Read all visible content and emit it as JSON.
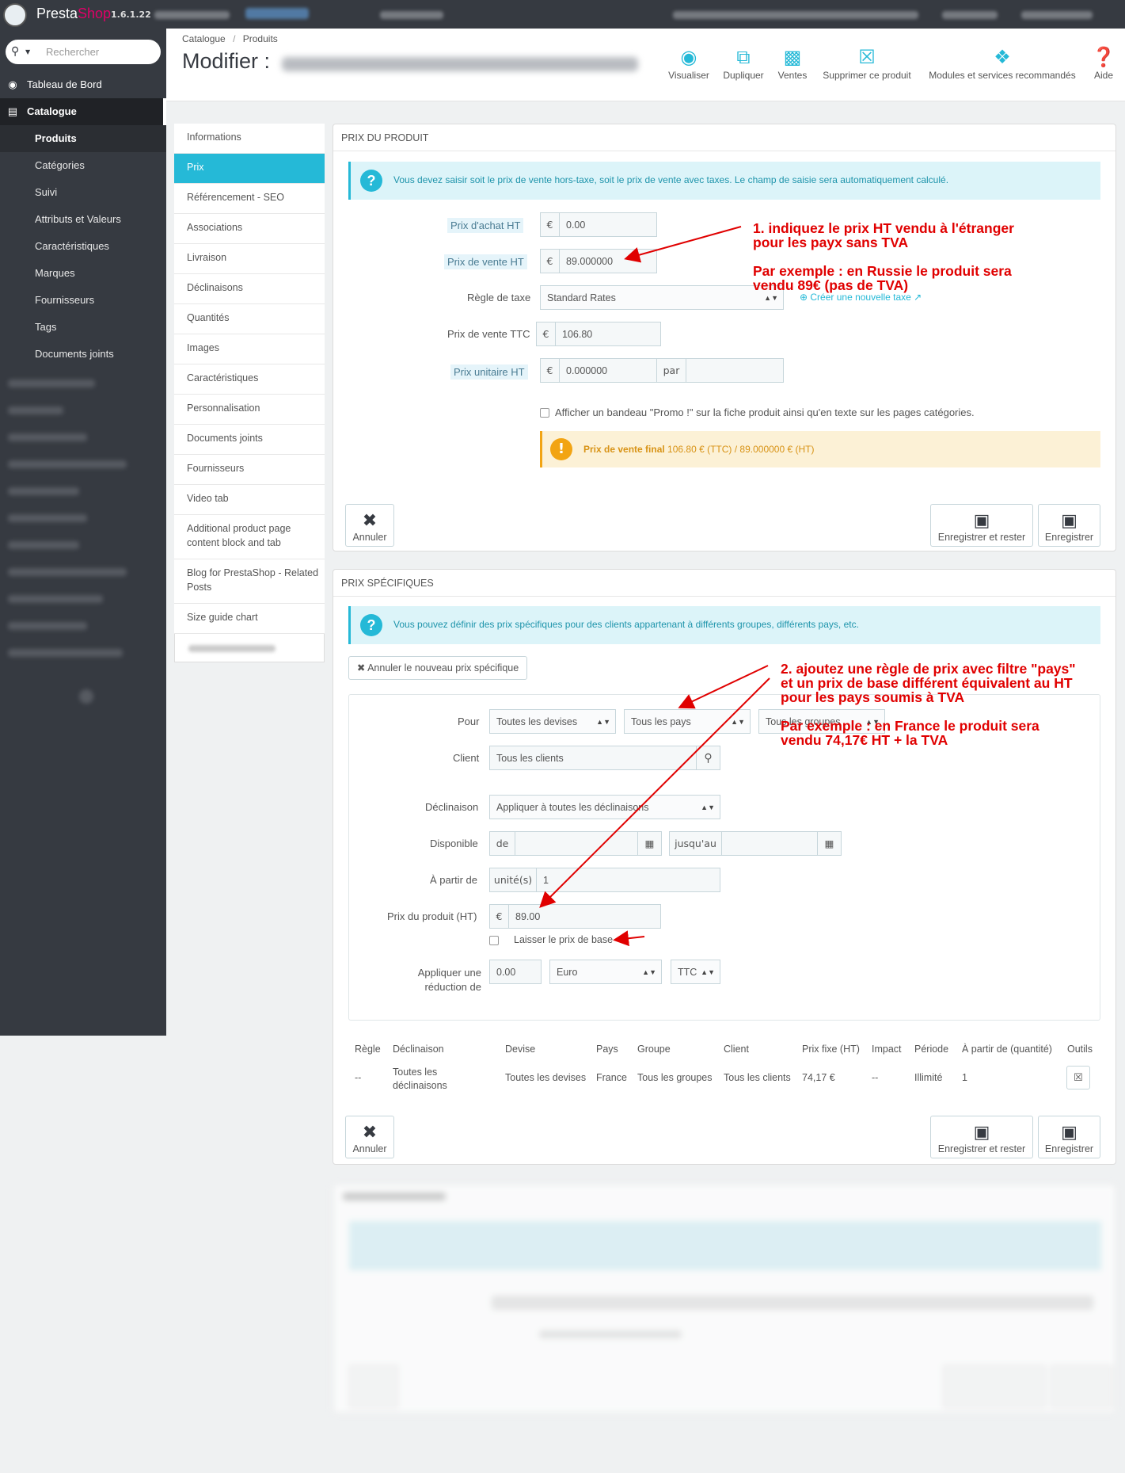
{
  "app": {
    "logo_presta": "Presta",
    "logo_shop": "Shop",
    "version": "1.6.1.22"
  },
  "sidebar": {
    "search_placeholder": "Rechercher",
    "dashboard": "Tableau de Bord",
    "catalogue": "Catalogue",
    "sub_items": [
      "Produits",
      "Catégories",
      "Suivi",
      "Attributs et Valeurs",
      "Caractéristiques",
      "Marques",
      "Fournisseurs",
      "Tags",
      "Documents joints"
    ]
  },
  "header": {
    "breadcrumb_1": "Catalogue",
    "breadcrumb_sep": "/",
    "breadcrumb_2": "Produits",
    "title": "Modifier :",
    "toolbar": [
      {
        "label": "Visualiser",
        "icon": "eye-icon"
      },
      {
        "label": "Dupliquer",
        "icon": "copy-icon"
      },
      {
        "label": "Ventes",
        "icon": "bar-chart-icon"
      },
      {
        "label": "Supprimer ce produit",
        "icon": "trash-icon"
      },
      {
        "label": "Modules et services recommandés",
        "icon": "puzzle-icon"
      },
      {
        "label": "Aide",
        "icon": "help-icon"
      }
    ]
  },
  "tabs": [
    "Informations",
    "Prix",
    "Référencement - SEO",
    "Associations",
    "Livraison",
    "Déclinaisons",
    "Quantités",
    "Images",
    "Caractéristiques",
    "Personnalisation",
    "Documents joints",
    "Fournisseurs",
    "Video tab",
    "Additional product page content block and tab",
    "Blog for PrestaShop - Related Posts",
    "Size guide chart"
  ],
  "price_panel": {
    "heading": "PRIX DU PRODUIT",
    "info": "Vous devez saisir soit le prix de vente hors-taxe, soit le prix de vente avec taxes. Le champ de saisie sera automatiquement calculé.",
    "purchase_label": "Prix d'achat HT",
    "purchase_value": "0.00",
    "sale_ht_label": "Prix de vente HT",
    "sale_ht_value": "89.000000",
    "tax_label": "Règle de taxe",
    "tax_value": "Standard Rates",
    "create_tax": "Créer une nouvelle taxe",
    "ttc_label": "Prix de vente TTC",
    "ttc_value": "106.80",
    "unit_label": "Prix unitaire HT",
    "unit_value": "0.000000",
    "unit_par": "par",
    "currency": "€",
    "promo_text": "Afficher un bandeau \"Promo !\" sur la fiche produit ainsi qu'en texte sur les pages catégories.",
    "final_label": "Prix de vente final",
    "final_value": "106.80 € (TTC) / 89.000000 € (HT)",
    "cancel": "Annuler",
    "save_stay": "Enregistrer et rester",
    "save": "Enregistrer"
  },
  "specific_panel": {
    "heading": "PRIX SPÉCIFIQUES",
    "info": "Vous pouvez définir des prix spécifiques pour des clients appartenant à différents groupes, différents pays, etc.",
    "cancel_new": "Annuler le nouveau prix spécifique",
    "pour_label": "Pour",
    "devises": "Toutes les devises",
    "pays": "Tous les pays",
    "groupes": "Tous les groupes",
    "client_label": "Client",
    "client_value": "Tous les clients",
    "decl_label": "Déclinaison",
    "decl_value": "Appliquer à toutes les déclinaisons",
    "dispo_label": "Disponible",
    "de": "de",
    "jusqu": "jusqu'au",
    "apartir_label": "À partir de",
    "unites": "unité(s)",
    "apartir_value": "1",
    "prix_label": "Prix du produit (HT)",
    "prix_value": "89.00",
    "laisser": "Laisser le prix de base",
    "reduc_label_1": "Appliquer une",
    "reduc_label_2": "réduction de",
    "reduc_value": "0.00",
    "reduc_currency": "Euro",
    "reduc_type": "TTC",
    "table": {
      "headers": [
        "Règle",
        "Déclinaison",
        "Devise",
        "Pays",
        "Groupe",
        "Client",
        "Prix fixe (HT)",
        "Impact",
        "Période",
        "À partir de (quantité)",
        "Outils"
      ],
      "row": [
        "--",
        "Toutes les déclinaisons",
        "Toutes les devises",
        "France",
        "Tous les groupes",
        "Tous les clients",
        "74,17 €",
        "--",
        "Illimité",
        "1"
      ]
    }
  },
  "annotations": {
    "a1_l1": "1. indiquez le prix HT vendu à l'étranger",
    "a1_l2": "pour les payx sans TVA",
    "a1_l3": "Par exemple : en Russie le produit sera",
    "a1_l4": "vendu 89€ (pas de TVA)",
    "a2_l1": "2. ajoutez une règle de prix avec filtre \"pays\"",
    "a2_l2": "et un prix de base différent équivalent au HT",
    "a2_l3": "pour les pays soumis à TVA",
    "a2_l4": "Par exemple : en France le produit sera",
    "a2_l5": "vendu 74,17€ HT + la TVA",
    "color": "#e00000"
  },
  "colors": {
    "accent": "#25b9d7",
    "sidebar": "#363a41",
    "warning": "#fcf1d6"
  }
}
